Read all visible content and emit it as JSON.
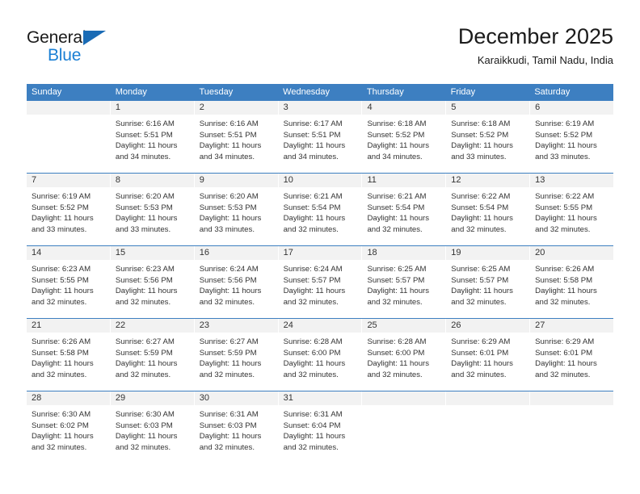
{
  "logo": {
    "word_top": "General",
    "word_bottom": "Blue",
    "triangle_color": "#1a6bb5",
    "blue_color": "#1a7fd4"
  },
  "header": {
    "title": "December 2025",
    "subtitle": "Karaikkudi, Tamil Nadu, India"
  },
  "theme": {
    "header_blue": "#3d7fc1",
    "day_band_gray": "#f2f2f2",
    "text": "#333333"
  },
  "weekdays": [
    "Sunday",
    "Monday",
    "Tuesday",
    "Wednesday",
    "Thursday",
    "Friday",
    "Saturday"
  ],
  "weeks": [
    [
      {
        "day": "",
        "empty": true
      },
      {
        "day": "1",
        "sunrise": "Sunrise: 6:16 AM",
        "sunset": "Sunset: 5:51 PM",
        "daylight": "Daylight: 11 hours and 34 minutes."
      },
      {
        "day": "2",
        "sunrise": "Sunrise: 6:16 AM",
        "sunset": "Sunset: 5:51 PM",
        "daylight": "Daylight: 11 hours and 34 minutes."
      },
      {
        "day": "3",
        "sunrise": "Sunrise: 6:17 AM",
        "sunset": "Sunset: 5:51 PM",
        "daylight": "Daylight: 11 hours and 34 minutes."
      },
      {
        "day": "4",
        "sunrise": "Sunrise: 6:18 AM",
        "sunset": "Sunset: 5:52 PM",
        "daylight": "Daylight: 11 hours and 34 minutes."
      },
      {
        "day": "5",
        "sunrise": "Sunrise: 6:18 AM",
        "sunset": "Sunset: 5:52 PM",
        "daylight": "Daylight: 11 hours and 33 minutes."
      },
      {
        "day": "6",
        "sunrise": "Sunrise: 6:19 AM",
        "sunset": "Sunset: 5:52 PM",
        "daylight": "Daylight: 11 hours and 33 minutes."
      }
    ],
    [
      {
        "day": "7",
        "sunrise": "Sunrise: 6:19 AM",
        "sunset": "Sunset: 5:52 PM",
        "daylight": "Daylight: 11 hours and 33 minutes."
      },
      {
        "day": "8",
        "sunrise": "Sunrise: 6:20 AM",
        "sunset": "Sunset: 5:53 PM",
        "daylight": "Daylight: 11 hours and 33 minutes."
      },
      {
        "day": "9",
        "sunrise": "Sunrise: 6:20 AM",
        "sunset": "Sunset: 5:53 PM",
        "daylight": "Daylight: 11 hours and 33 minutes."
      },
      {
        "day": "10",
        "sunrise": "Sunrise: 6:21 AM",
        "sunset": "Sunset: 5:54 PM",
        "daylight": "Daylight: 11 hours and 32 minutes."
      },
      {
        "day": "11",
        "sunrise": "Sunrise: 6:21 AM",
        "sunset": "Sunset: 5:54 PM",
        "daylight": "Daylight: 11 hours and 32 minutes."
      },
      {
        "day": "12",
        "sunrise": "Sunrise: 6:22 AM",
        "sunset": "Sunset: 5:54 PM",
        "daylight": "Daylight: 11 hours and 32 minutes."
      },
      {
        "day": "13",
        "sunrise": "Sunrise: 6:22 AM",
        "sunset": "Sunset: 5:55 PM",
        "daylight": "Daylight: 11 hours and 32 minutes."
      }
    ],
    [
      {
        "day": "14",
        "sunrise": "Sunrise: 6:23 AM",
        "sunset": "Sunset: 5:55 PM",
        "daylight": "Daylight: 11 hours and 32 minutes."
      },
      {
        "day": "15",
        "sunrise": "Sunrise: 6:23 AM",
        "sunset": "Sunset: 5:56 PM",
        "daylight": "Daylight: 11 hours and 32 minutes."
      },
      {
        "day": "16",
        "sunrise": "Sunrise: 6:24 AM",
        "sunset": "Sunset: 5:56 PM",
        "daylight": "Daylight: 11 hours and 32 minutes."
      },
      {
        "day": "17",
        "sunrise": "Sunrise: 6:24 AM",
        "sunset": "Sunset: 5:57 PM",
        "daylight": "Daylight: 11 hours and 32 minutes."
      },
      {
        "day": "18",
        "sunrise": "Sunrise: 6:25 AM",
        "sunset": "Sunset: 5:57 PM",
        "daylight": "Daylight: 11 hours and 32 minutes."
      },
      {
        "day": "19",
        "sunrise": "Sunrise: 6:25 AM",
        "sunset": "Sunset: 5:57 PM",
        "daylight": "Daylight: 11 hours and 32 minutes."
      },
      {
        "day": "20",
        "sunrise": "Sunrise: 6:26 AM",
        "sunset": "Sunset: 5:58 PM",
        "daylight": "Daylight: 11 hours and 32 minutes."
      }
    ],
    [
      {
        "day": "21",
        "sunrise": "Sunrise: 6:26 AM",
        "sunset": "Sunset: 5:58 PM",
        "daylight": "Daylight: 11 hours and 32 minutes."
      },
      {
        "day": "22",
        "sunrise": "Sunrise: 6:27 AM",
        "sunset": "Sunset: 5:59 PM",
        "daylight": "Daylight: 11 hours and 32 minutes."
      },
      {
        "day": "23",
        "sunrise": "Sunrise: 6:27 AM",
        "sunset": "Sunset: 5:59 PM",
        "daylight": "Daylight: 11 hours and 32 minutes."
      },
      {
        "day": "24",
        "sunrise": "Sunrise: 6:28 AM",
        "sunset": "Sunset: 6:00 PM",
        "daylight": "Daylight: 11 hours and 32 minutes."
      },
      {
        "day": "25",
        "sunrise": "Sunrise: 6:28 AM",
        "sunset": "Sunset: 6:00 PM",
        "daylight": "Daylight: 11 hours and 32 minutes."
      },
      {
        "day": "26",
        "sunrise": "Sunrise: 6:29 AM",
        "sunset": "Sunset: 6:01 PM",
        "daylight": "Daylight: 11 hours and 32 minutes."
      },
      {
        "day": "27",
        "sunrise": "Sunrise: 6:29 AM",
        "sunset": "Sunset: 6:01 PM",
        "daylight": "Daylight: 11 hours and 32 minutes."
      }
    ],
    [
      {
        "day": "28",
        "sunrise": "Sunrise: 6:30 AM",
        "sunset": "Sunset: 6:02 PM",
        "daylight": "Daylight: 11 hours and 32 minutes."
      },
      {
        "day": "29",
        "sunrise": "Sunrise: 6:30 AM",
        "sunset": "Sunset: 6:03 PM",
        "daylight": "Daylight: 11 hours and 32 minutes."
      },
      {
        "day": "30",
        "sunrise": "Sunrise: 6:31 AM",
        "sunset": "Sunset: 6:03 PM",
        "daylight": "Daylight: 11 hours and 32 minutes."
      },
      {
        "day": "31",
        "sunrise": "Sunrise: 6:31 AM",
        "sunset": "Sunset: 6:04 PM",
        "daylight": "Daylight: 11 hours and 32 minutes."
      },
      {
        "day": "",
        "empty": true
      },
      {
        "day": "",
        "empty": true
      },
      {
        "day": "",
        "empty": true
      }
    ]
  ]
}
